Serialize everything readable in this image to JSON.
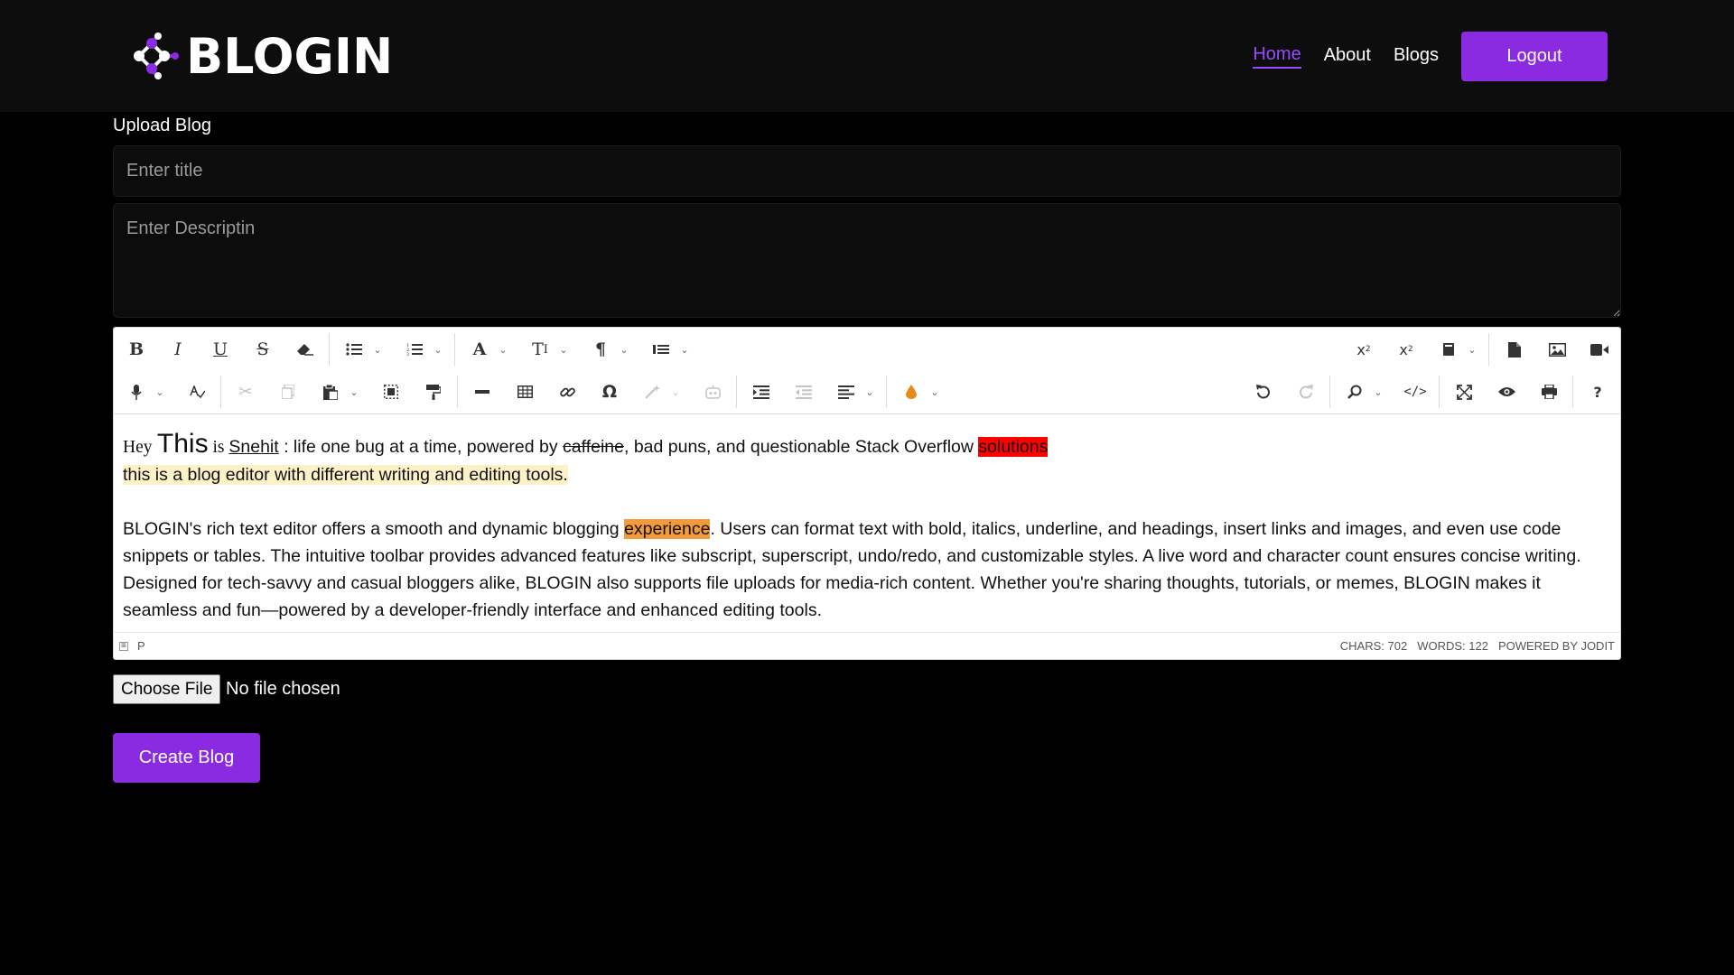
{
  "brand": {
    "name": "BLOGIN",
    "icon": "molecule-logo-icon",
    "accent": "#8a2be2"
  },
  "nav": {
    "items": [
      {
        "label": "Home",
        "active": true
      },
      {
        "label": "About",
        "active": false
      },
      {
        "label": "Blogs",
        "active": false
      }
    ],
    "logout_label": "Logout"
  },
  "form": {
    "section_label": "Upload Blog",
    "title_placeholder": "Enter title",
    "description_placeholder": "Enter Descriptin",
    "file_button_label": "Choose File",
    "file_status": "No file chosen",
    "submit_label": "Create Blog"
  },
  "editor": {
    "toolbar_row1": [
      "bold-icon",
      "italic-icon",
      "underline-icon",
      "strikethrough-icon",
      "eraser-icon",
      "bullet-list-icon",
      "numbered-list-icon",
      "font-icon",
      "font-size-icon",
      "paragraph-icon",
      "line-height-icon",
      "superscript-icon",
      "subscript-icon",
      "classname-icon",
      "file-icon",
      "image-icon",
      "video-icon"
    ],
    "toolbar_row2": [
      "microphone-icon",
      "spellcheck-icon",
      "cut-icon",
      "copy-icon",
      "paste-icon",
      "select-all-icon",
      "copy-format-icon",
      "horizontal-rule-icon",
      "table-icon",
      "link-icon",
      "symbols-icon",
      "ai-assistant-icon",
      "ai-commands-icon",
      "indent-icon",
      "outdent-icon",
      "align-icon",
      "brush-icon",
      "undo-icon",
      "redo-icon",
      "find-icon",
      "source-icon",
      "fullscreen-icon",
      "preview-icon",
      "print-icon",
      "help-icon"
    ],
    "content": {
      "line1": {
        "hey": "Hey",
        "this": "This",
        "is": " is ",
        "name": "Snehit",
        "mid": " : life one bug at a time, powered by ",
        "strike": "caffeine",
        "after": ", bad puns, and questionable Stack Overflow ",
        "red": "solutions"
      },
      "line2": "this is a blog editor with different writing and editing tools.",
      "para_before": "BLOGIN's rich text editor offers a smooth and dynamic blogging ",
      "para_highlight": "experience",
      "para_after": ". Users can format text with bold, italics, underline, and headings, insert links and images, and even use code snippets or tables. The intuitive toolbar provides advanced features like subscript, superscript, undo/redo, and customizable styles. A live word and character count ensures concise writing. Designed for tech-savvy and casual bloggers alike, BLOGIN also supports file uploads for media-rich content. Whether you're sharing thoughts, tutorials, or memes, BLOGIN makes it seamless and fun—powered by a developer-friendly interface and enhanced editing tools."
    },
    "status": {
      "path": "P",
      "chars": "Chars: 702",
      "words": "Words: 122",
      "powered": "Powered by Jodit"
    }
  }
}
